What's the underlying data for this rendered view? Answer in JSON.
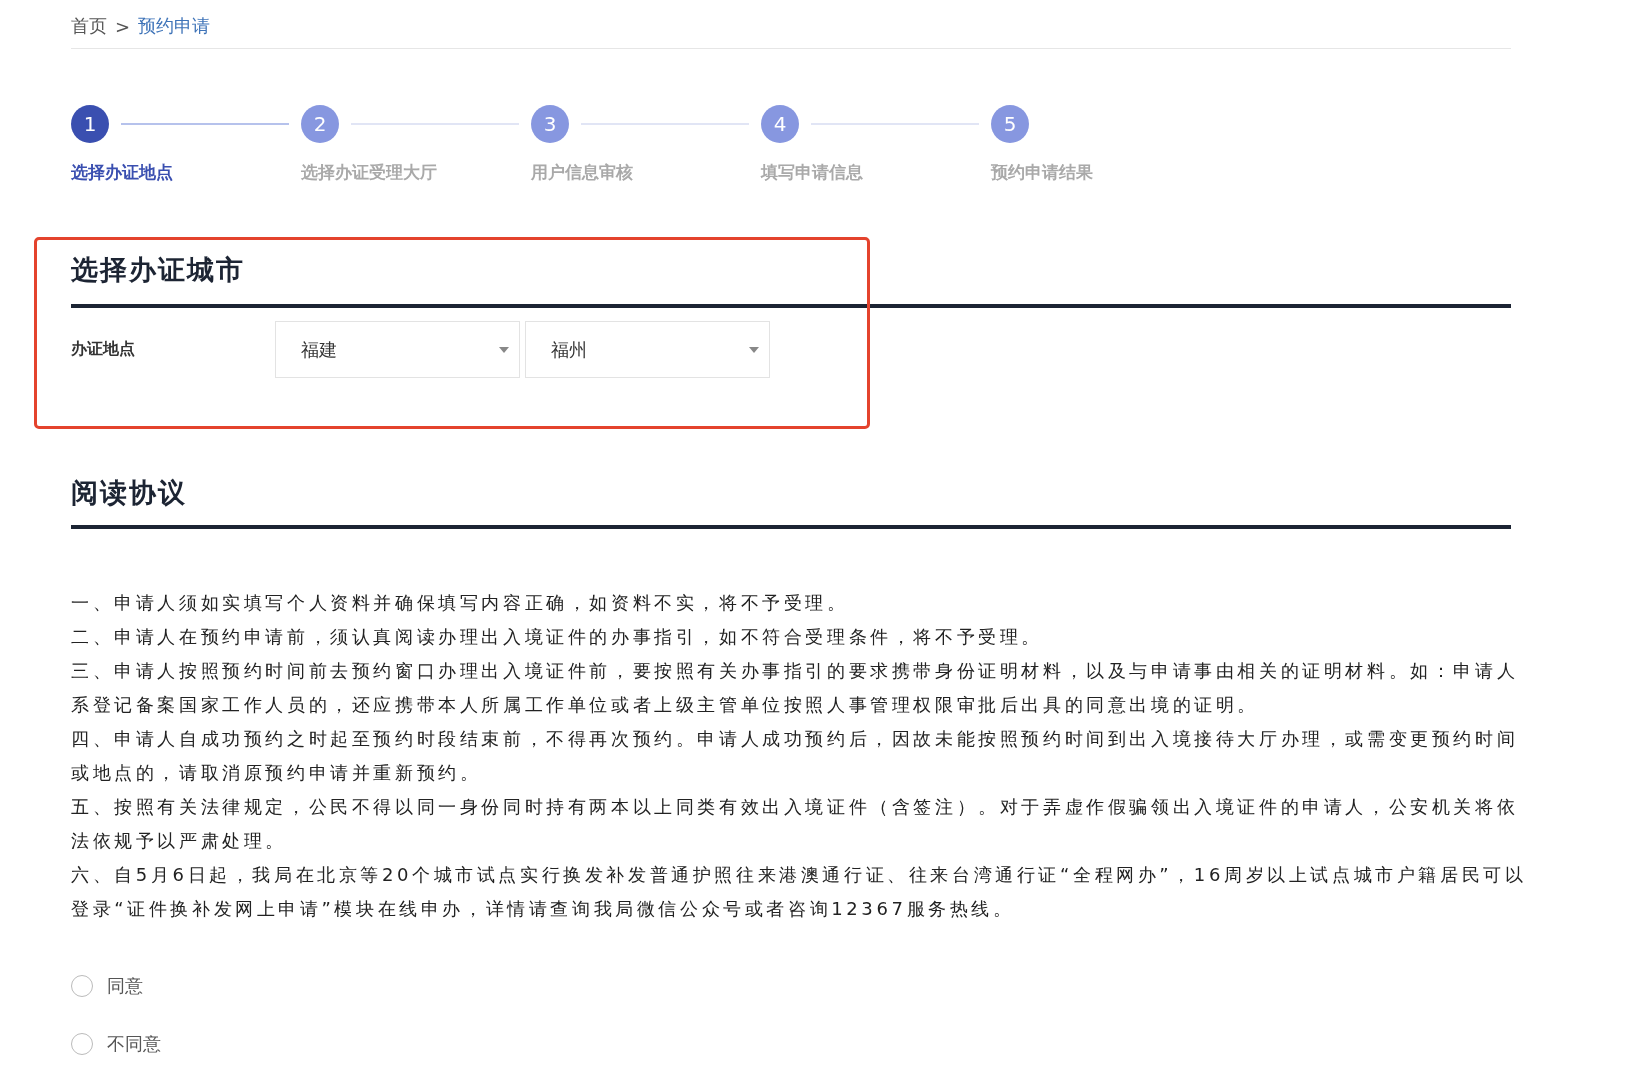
{
  "breadcrumb": {
    "items": [
      {
        "label": "首页",
        "current": false
      },
      {
        "label": "预约申请",
        "current": true
      }
    ],
    "separator": ">"
  },
  "steps": [
    {
      "number": "1",
      "label": "选择办证地点",
      "selected": true
    },
    {
      "number": "2",
      "label": "选择办证受理大厅",
      "selected": false
    },
    {
      "number": "3",
      "label": "用户信息审核",
      "selected": false
    },
    {
      "number": "4",
      "label": "填写申请信息",
      "selected": false
    },
    {
      "number": "5",
      "label": "预约申请结果",
      "selected": false
    }
  ],
  "city_section": {
    "title": "选择办证城市",
    "highlighted": true,
    "field_label": "办证地点",
    "selects": [
      {
        "value": "福建"
      },
      {
        "value": "福州"
      }
    ]
  },
  "agreement": {
    "title": "阅读协议",
    "paragraphs": [
      "一、申请人须如实填写个人资料并确保填写内容正确，如资料不实，将不予受理。",
      "二、申请人在预约申请前，须认真阅读办理出入境证件的办事指引，如不符合受理条件，将不予受理。",
      "三、申请人按照预约时间前去预约窗口办理出入境证件前，要按照有关办事指引的要求携带身份证明材料，以及与申请事由相关的证明材料。如：申请人系登记备案国家工作人员的，还应携带本人所属工作单位或者上级主管单位按照人事管理权限审批后出具的同意出境的证明。",
      "四、申请人自成功预约之时起至预约时段结束前，不得再次预约。申请人成功预约后，因故未能按照预约时间到出入境接待大厅办理，或需变更预约时间或地点的，请取消原预约申请并重新预约。",
      "五、按照有关法律规定，公民不得以同一身份同时持有两本以上同类有效出入境证件（含签注）。对于弄虚作假骗领出入境证件的申请人，公安机关将依法依规予以严肃处理。",
      "六、自5月6日起，我局在北京等20个城市试点实行换发补发普通护照往来港澳通行证、往来台湾通行证“全程网办”，16周岁以上试点城市户籍居民可以登录“证件换补发网上申请”模块在线申办，详情请查询我局微信公众号或者咨询12367服务热线。"
    ],
    "options": [
      {
        "label": "同意",
        "selected": false
      },
      {
        "label": "不同意",
        "selected": false
      }
    ]
  }
}
